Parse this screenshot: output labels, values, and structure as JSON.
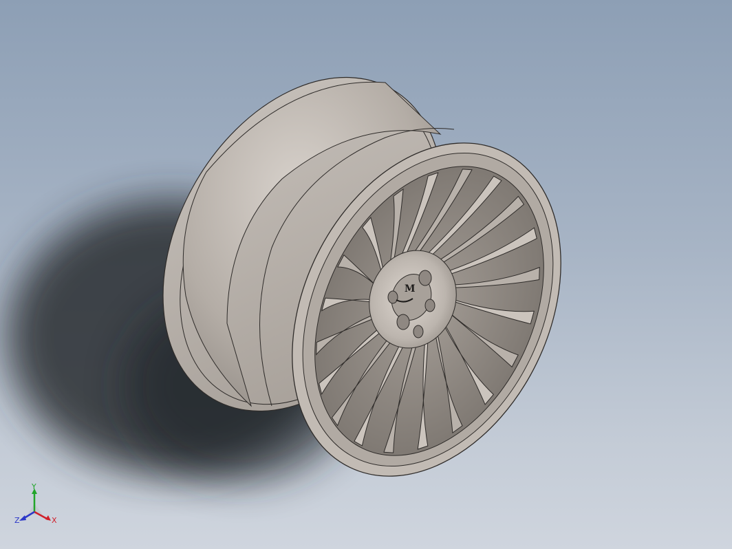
{
  "viewport": {
    "model": "wheel-rim",
    "background_top": "#8d9fb5",
    "background_bottom": "#cfd5de",
    "model_color": "#b7b0aa",
    "spoke_count": 20,
    "lug_hole_count": 5
  },
  "hub": {
    "logo_letter": "M"
  },
  "triad": {
    "x_label": "X",
    "y_label": "Y",
    "z_label": "Z",
    "x_color": "#d0202a",
    "y_color": "#22a52a",
    "z_color": "#2b37c8"
  }
}
